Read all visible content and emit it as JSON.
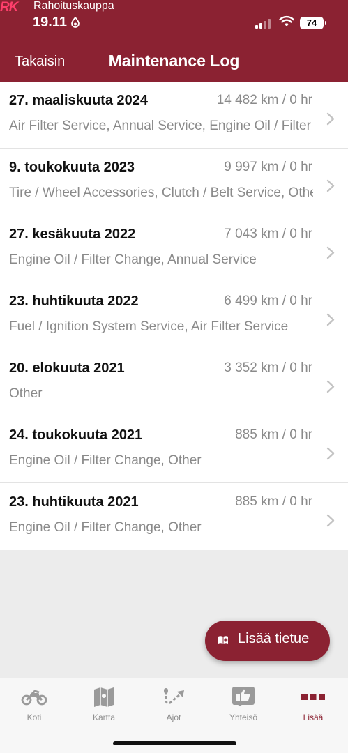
{
  "status_bar": {
    "logo": "RK",
    "brand": "Rahoituskauppa",
    "time": "19.11",
    "battery": "74"
  },
  "header": {
    "back_label": "Takaisin",
    "title": "Maintenance Log"
  },
  "entries": [
    {
      "date": "27. maaliskuuta 2024",
      "km": "14 482 km / 0 hr",
      "services": "Air Filter Service, Annual Service, Engine Oil / Filter Change"
    },
    {
      "date": "9. toukokuuta 2023",
      "km": "9 997 km / 0 hr",
      "services": "Tire / Wheel Accessories, Clutch / Belt Service, Other"
    },
    {
      "date": "27. kesäkuuta 2022",
      "km": "7 043 km / 0 hr",
      "services": "Engine Oil / Filter Change, Annual Service"
    },
    {
      "date": "23. huhtikuuta 2022",
      "km": "6 499 km / 0 hr",
      "services": "Fuel / Ignition System Service, Air Filter Service"
    },
    {
      "date": "20. elokuuta 2021",
      "km": "3 352 km / 0 hr",
      "services": "Other"
    },
    {
      "date": "24. toukokuuta 2021",
      "km": "885 km / 0 hr",
      "services": "Engine Oil / Filter Change, Other"
    },
    {
      "date": "23. huhtikuuta 2021",
      "km": "885 km / 0 hr",
      "services": "Engine Oil / Filter Change, Other"
    }
  ],
  "fab": {
    "label": "Lisää tietue"
  },
  "tabs": [
    {
      "label": "Koti",
      "icon": "motorcycle-icon"
    },
    {
      "label": "Kartta",
      "icon": "map-icon"
    },
    {
      "label": "Ajot",
      "icon": "route-icon"
    },
    {
      "label": "Yhteisö",
      "icon": "thumbs-up-icon"
    },
    {
      "label": "Lisää",
      "icon": "more-icon"
    }
  ],
  "colors": {
    "brand": "#8b2232",
    "muted": "#8a8a8a",
    "logo": "#ff3f6c"
  }
}
